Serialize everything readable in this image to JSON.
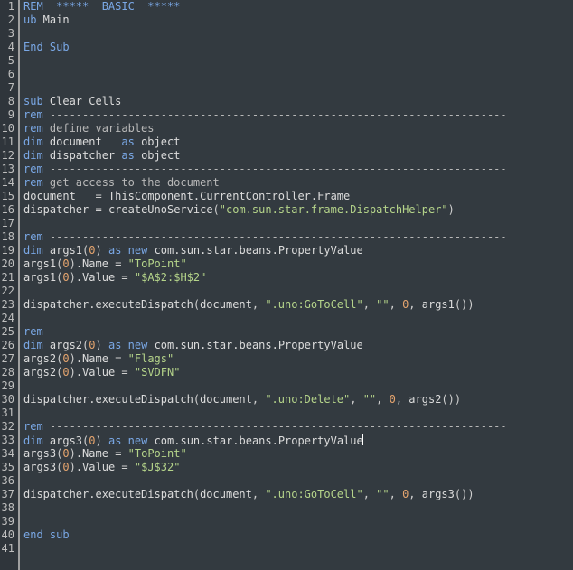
{
  "code": {
    "lines": [
      [
        [
          "kw",
          "REM  *****  BASIC  *****"
        ]
      ],
      [
        [
          "kw",
          "ub"
        ],
        [
          "id",
          " Main"
        ]
      ],
      [],
      [
        [
          "kw",
          "End Sub"
        ]
      ],
      [],
      [],
      [],
      [
        [
          "kw",
          "sub"
        ],
        [
          "id",
          " Clear_Cells"
        ]
      ],
      [
        [
          "kw",
          "rem"
        ],
        [
          "dash",
          " ----------------------------------------------------------------------"
        ]
      ],
      [
        [
          "kw",
          "rem"
        ],
        [
          "com",
          " define variables"
        ]
      ],
      [
        [
          "kw",
          "dim"
        ],
        [
          "id",
          " document   "
        ],
        [
          "kw",
          "as"
        ],
        [
          "id",
          " object"
        ]
      ],
      [
        [
          "kw",
          "dim"
        ],
        [
          "id",
          " dispatcher "
        ],
        [
          "kw",
          "as"
        ],
        [
          "id",
          " object"
        ]
      ],
      [
        [
          "kw",
          "rem"
        ],
        [
          "dash",
          " ----------------------------------------------------------------------"
        ]
      ],
      [
        [
          "kw",
          "rem"
        ],
        [
          "com",
          " get access to the document"
        ]
      ],
      [
        [
          "id",
          "document   "
        ],
        [
          "punc",
          "="
        ],
        [
          "id",
          " ThisComponent.CurrentController.Frame"
        ]
      ],
      [
        [
          "id",
          "dispatcher "
        ],
        [
          "punc",
          "="
        ],
        [
          "id",
          " createUnoService"
        ],
        [
          "punc",
          "("
        ],
        [
          "str",
          "\"com.sun.star.frame.DispatchHelper\""
        ],
        [
          "punc",
          ")"
        ]
      ],
      [],
      [
        [
          "kw",
          "rem"
        ],
        [
          "dash",
          " ----------------------------------------------------------------------"
        ]
      ],
      [
        [
          "kw",
          "dim"
        ],
        [
          "id",
          " args1"
        ],
        [
          "punc",
          "("
        ],
        [
          "num",
          "0"
        ],
        [
          "punc",
          ")"
        ],
        [
          "id",
          " "
        ],
        [
          "kw",
          "as new"
        ],
        [
          "id",
          " com.sun.star.beans.PropertyValue"
        ]
      ],
      [
        [
          "id",
          "args1"
        ],
        [
          "punc",
          "("
        ],
        [
          "num",
          "0"
        ],
        [
          "punc",
          ")"
        ],
        [
          "id",
          ".Name "
        ],
        [
          "punc",
          "="
        ],
        [
          "id",
          " "
        ],
        [
          "str",
          "\"ToPoint\""
        ]
      ],
      [
        [
          "id",
          "args1"
        ],
        [
          "punc",
          "("
        ],
        [
          "num",
          "0"
        ],
        [
          "punc",
          ")"
        ],
        [
          "id",
          ".Value "
        ],
        [
          "punc",
          "="
        ],
        [
          "id",
          " "
        ],
        [
          "str",
          "\"$A$2:$H$2\""
        ]
      ],
      [],
      [
        [
          "id",
          "dispatcher.executeDispatch"
        ],
        [
          "punc",
          "("
        ],
        [
          "id",
          "document"
        ],
        [
          "punc",
          ", "
        ],
        [
          "str",
          "\".uno:GoToCell\""
        ],
        [
          "punc",
          ", "
        ],
        [
          "str",
          "\"\""
        ],
        [
          "punc",
          ", "
        ],
        [
          "num",
          "0"
        ],
        [
          "punc",
          ", "
        ],
        [
          "id",
          "args1"
        ],
        [
          "punc",
          "())"
        ]
      ],
      [],
      [
        [
          "kw",
          "rem"
        ],
        [
          "dash",
          " ----------------------------------------------------------------------"
        ]
      ],
      [
        [
          "kw",
          "dim"
        ],
        [
          "id",
          " args2"
        ],
        [
          "punc",
          "("
        ],
        [
          "num",
          "0"
        ],
        [
          "punc",
          ")"
        ],
        [
          "id",
          " "
        ],
        [
          "kw",
          "as new"
        ],
        [
          "id",
          " com.sun.star.beans.PropertyValue"
        ]
      ],
      [
        [
          "id",
          "args2"
        ],
        [
          "punc",
          "("
        ],
        [
          "num",
          "0"
        ],
        [
          "punc",
          ")"
        ],
        [
          "id",
          ".Name "
        ],
        [
          "punc",
          "="
        ],
        [
          "id",
          " "
        ],
        [
          "str",
          "\"Flags\""
        ]
      ],
      [
        [
          "id",
          "args2"
        ],
        [
          "punc",
          "("
        ],
        [
          "num",
          "0"
        ],
        [
          "punc",
          ")"
        ],
        [
          "id",
          ".Value "
        ],
        [
          "punc",
          "="
        ],
        [
          "id",
          " "
        ],
        [
          "str",
          "\"SVDFN\""
        ]
      ],
      [],
      [
        [
          "id",
          "dispatcher.executeDispatch"
        ],
        [
          "punc",
          "("
        ],
        [
          "id",
          "document"
        ],
        [
          "punc",
          ", "
        ],
        [
          "str",
          "\".uno:Delete\""
        ],
        [
          "punc",
          ", "
        ],
        [
          "str",
          "\"\""
        ],
        [
          "punc",
          ", "
        ],
        [
          "num",
          "0"
        ],
        [
          "punc",
          ", "
        ],
        [
          "id",
          "args2"
        ],
        [
          "punc",
          "())"
        ]
      ],
      [],
      [
        [
          "kw",
          "rem"
        ],
        [
          "dash",
          " ----------------------------------------------------------------------"
        ]
      ],
      [
        [
          "kw",
          "dim"
        ],
        [
          "id",
          " args3"
        ],
        [
          "punc",
          "("
        ],
        [
          "num",
          "0"
        ],
        [
          "punc",
          ")"
        ],
        [
          "id",
          " "
        ],
        [
          "kw",
          "as new"
        ],
        [
          "id",
          " com.sun.star.beans.PropertyValue"
        ],
        [
          "caret",
          ""
        ]
      ],
      [
        [
          "id",
          "args3"
        ],
        [
          "punc",
          "("
        ],
        [
          "num",
          "0"
        ],
        [
          "punc",
          ")"
        ],
        [
          "id",
          ".Name "
        ],
        [
          "punc",
          "="
        ],
        [
          "id",
          " "
        ],
        [
          "str",
          "\"ToPoint\""
        ]
      ],
      [
        [
          "id",
          "args3"
        ],
        [
          "punc",
          "("
        ],
        [
          "num",
          "0"
        ],
        [
          "punc",
          ")"
        ],
        [
          "id",
          ".Value "
        ],
        [
          "punc",
          "="
        ],
        [
          "id",
          " "
        ],
        [
          "str",
          "\"$J$32\""
        ]
      ],
      [],
      [
        [
          "id",
          "dispatcher.executeDispatch"
        ],
        [
          "punc",
          "("
        ],
        [
          "id",
          "document"
        ],
        [
          "punc",
          ", "
        ],
        [
          "str",
          "\".uno:GoToCell\""
        ],
        [
          "punc",
          ", "
        ],
        [
          "str",
          "\"\""
        ],
        [
          "punc",
          ", "
        ],
        [
          "num",
          "0"
        ],
        [
          "punc",
          ", "
        ],
        [
          "id",
          "args3"
        ],
        [
          "punc",
          "())"
        ]
      ],
      [],
      [],
      [
        [
          "kw",
          "end sub"
        ]
      ],
      []
    ],
    "total_lines": 41
  }
}
